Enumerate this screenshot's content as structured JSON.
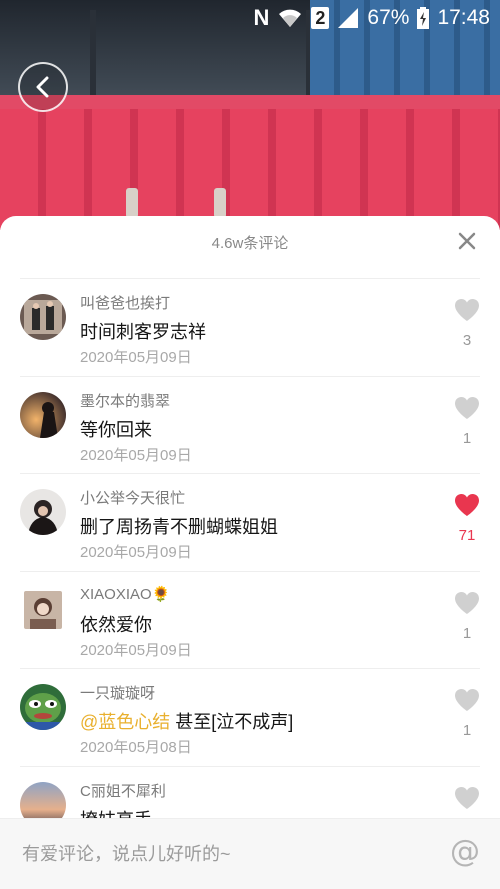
{
  "status_bar": {
    "network_badge": "2",
    "battery": "67%",
    "time": "17:48",
    "icons": [
      "nfc-icon",
      "wifi-icon",
      "sim-badge",
      "signal-icon",
      "battery-icon"
    ]
  },
  "comments_panel": {
    "title": "4.6w条评论",
    "close_icon": "close-icon"
  },
  "comments": [
    {
      "username": "叫爸爸也挨打",
      "text": "时间刺客罗志祥",
      "date": "2020年05月09日",
      "likes": "3",
      "liked": false
    },
    {
      "username": "墨尔本的翡翠",
      "text": "等你回来",
      "date": "2020年05月09日",
      "likes": "1",
      "liked": false
    },
    {
      "username": "小公举今天很忙",
      "text": "删了周扬青不删蝴蝶姐姐",
      "date": "2020年05月09日",
      "likes": "71",
      "liked": true
    },
    {
      "username": "XIAOXIAO🌻",
      "text": "依然爱你",
      "date": "2020年05月09日",
      "likes": "1",
      "liked": false
    },
    {
      "username": "一只璇璇呀",
      "mention": "@蓝色心结",
      "text": " 甚至[泣不成声]",
      "date": "2020年05月08日",
      "likes": "1",
      "liked": false
    },
    {
      "username": "C丽姐不犀利",
      "text": "撩妹高手",
      "date": "",
      "likes": "",
      "liked": false
    }
  ],
  "input": {
    "placeholder": "有爱评论，说点儿好听的~",
    "at_symbol": "@"
  },
  "colors": {
    "liked": "#e9364f",
    "mention": "#e9b02e",
    "unliked": "#d0d0d0"
  }
}
